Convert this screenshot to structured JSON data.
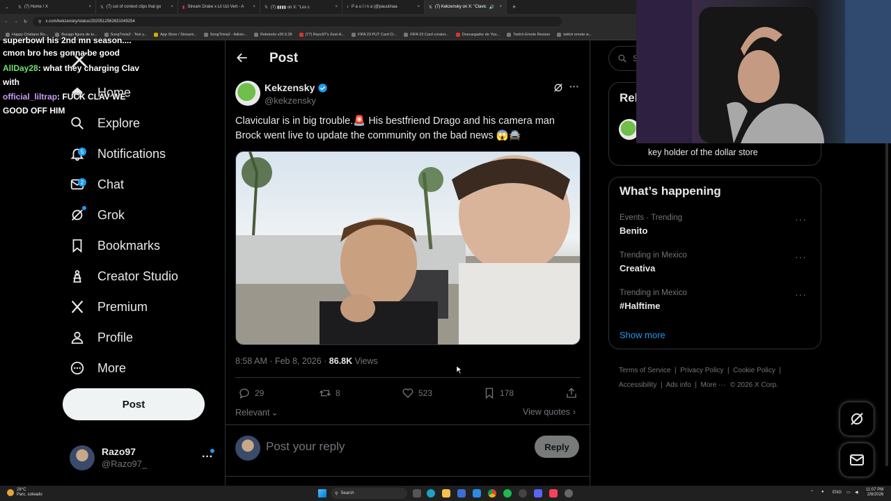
{
  "browser": {
    "tabs": [
      {
        "title": "(7) Home / X"
      },
      {
        "title": "(7) cut of context clips that go"
      },
      {
        "title": "Stream Drake x Lil Uzi Vert - A"
      },
      {
        "title": "(7) ▮▮▮▮ on X: \"Los c"
      },
      {
        "title": "P a u l i n a (@pauulinaa"
      },
      {
        "title": "(7) Kekzensky on X: \"Clavic"
      }
    ],
    "url": "x.com/kekzensky/status/2020512562631049254",
    "bookmarks": [
      "Happy Cristiano Ro...",
      "Burago figura de to...",
      "SongTrivia2 - Test y...",
      "App Store / Streami...",
      "SongTrivia2 - Adivin...",
      "Reletools v26.0.28",
      "(77) Razo97's Zest-A...",
      "FIFA 23 PUT Card Cr...",
      "FIFA 23 Card creator...",
      "Descargador de You...",
      "Twitch Emote Resizer",
      "twitch emote w..."
    ]
  },
  "chat": [
    {
      "user": "",
      "text": "superbowl his 2nd mn season...."
    },
    {
      "user": "",
      "text": "cmon bro hes gonna be good"
    },
    {
      "user": "AllDay28",
      "text": ": what they charging Clav with"
    },
    {
      "user": "official_liltrap",
      "text": ": FUCK CLAV WE GOOD OFF HIM"
    }
  ],
  "nav": {
    "home": "Home",
    "explore": "Explore",
    "notifications": "Notifications",
    "notifications_badge": "5",
    "chat": "Chat",
    "chat_badge": "2",
    "grok": "Grok",
    "bookmarks": "Bookmarks",
    "creator_studio": "Creator Studio",
    "premium": "Premium",
    "profile": "Profile",
    "more": "More",
    "post_button": "Post"
  },
  "account": {
    "name": "Razo97",
    "handle": "@Razo97_"
  },
  "header": {
    "title": "Post"
  },
  "post": {
    "author_name": "Kekzensky",
    "author_handle": "@kekzensky",
    "text": "Clavicular is in big trouble.🚨 His bestfriend Drago and his camera man Brock went live to update the community on the bad news 😱🚔",
    "time": "8:58 AM · Feb 8, 2026 · ",
    "views_count": "86.8K",
    "views_label": " Views",
    "replies": "29",
    "reposts": "8",
    "likes": "523",
    "bookmarks": "178",
    "sort_label": "Relevant",
    "view_quotes": "View quotes"
  },
  "reply": {
    "placeholder": "Post your reply",
    "button": "Reply"
  },
  "right": {
    "search_placeholder": "Se",
    "relevant_title": "Rel",
    "relevant_bio": "key holder of the dollar store",
    "happening_title": "What’s happening",
    "trends": [
      {
        "context": "Events · Trending",
        "name": "Benito"
      },
      {
        "context": "Trending in Mexico",
        "name": "Creativa"
      },
      {
        "context": "Trending in Mexico",
        "name": "#Halftime"
      }
    ],
    "show_more": "Show more",
    "footer_links": [
      "Terms of Service",
      "Privacy Policy",
      "Cookie Policy",
      "Accessibility",
      "Ads info",
      "More ···",
      "© 2026 X Corp."
    ]
  },
  "taskbar": {
    "weather_temp": "28°C",
    "weather_desc": "Parc. soleado",
    "search": "Search",
    "lang": "ENG",
    "time": "11:07 PM",
    "date": "2/8/2026"
  },
  "colors": {
    "accent": "#1d9bf0",
    "background": "#000000",
    "border": "#2f3336",
    "muted": "#71767b"
  }
}
